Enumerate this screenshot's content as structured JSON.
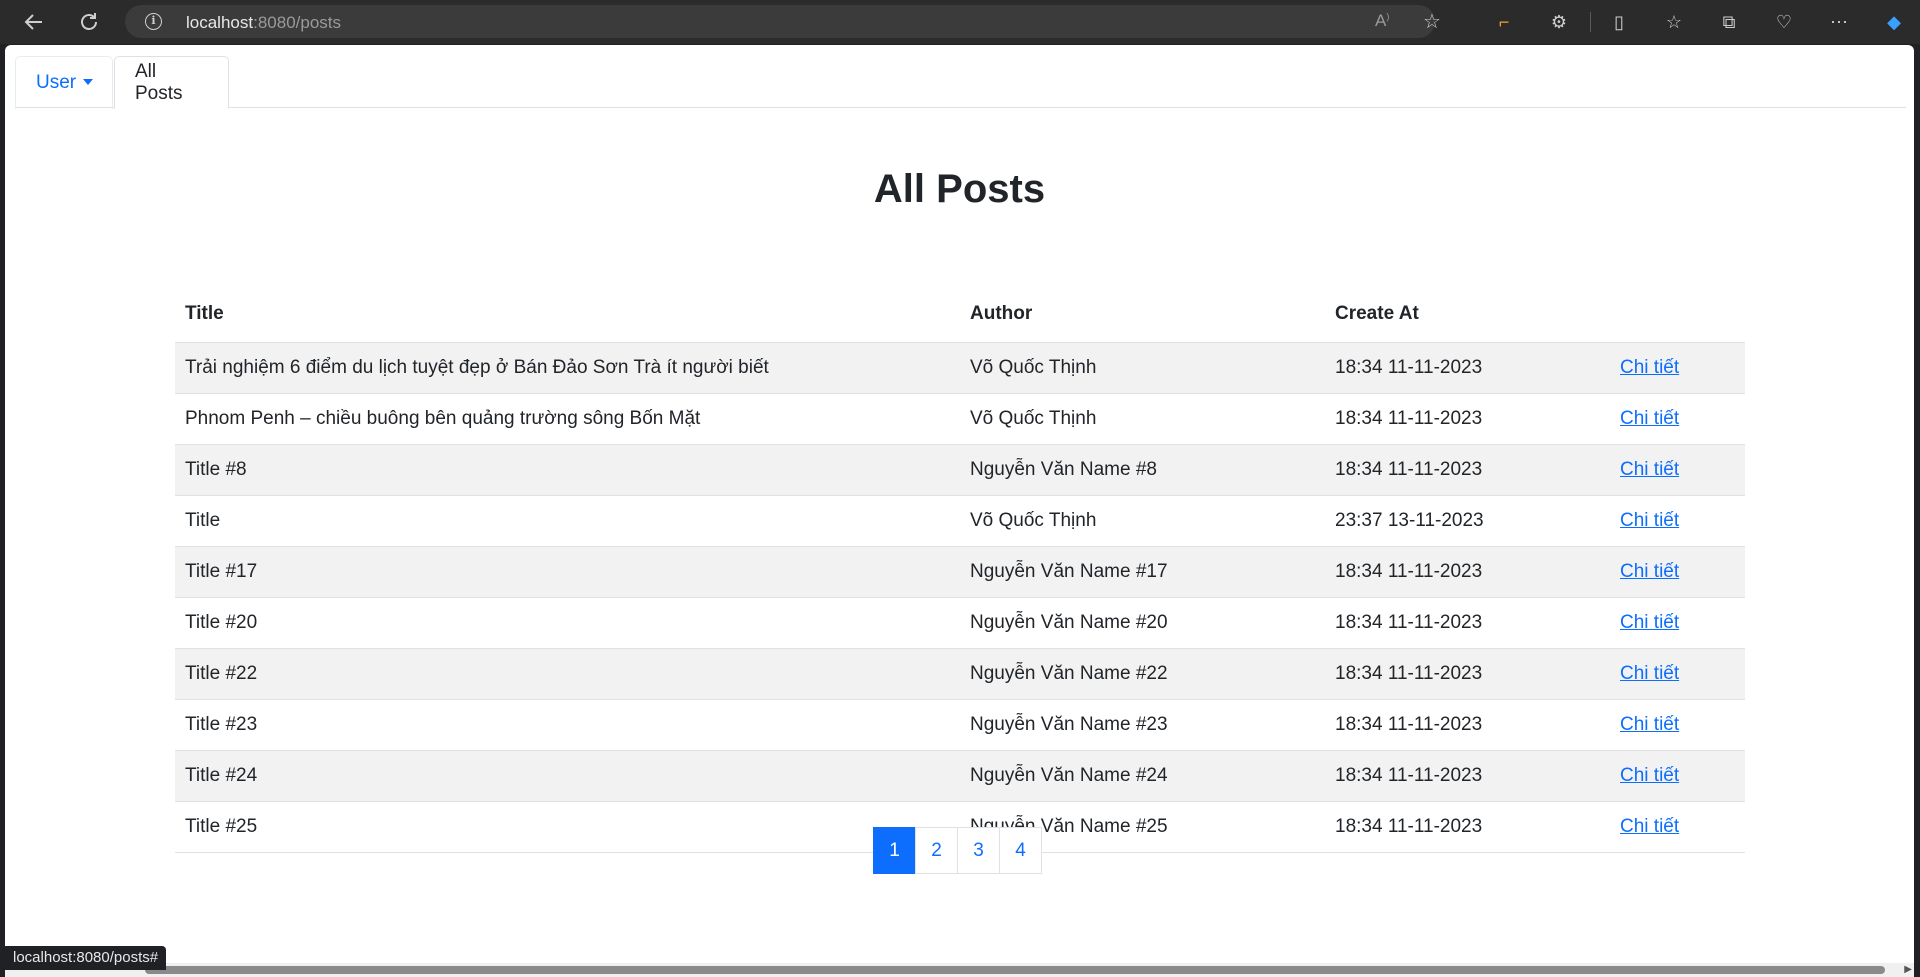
{
  "browser": {
    "url_host": "localhost",
    "url_rest": ":8080/posts",
    "status_url": "localhost:8080/posts#"
  },
  "tabs": {
    "user_label": "User",
    "posts_label": "All Posts"
  },
  "page_title": "All Posts",
  "table": {
    "headers": [
      "Title",
      "Author",
      "Create At",
      ""
    ],
    "link_label": "Chi tiết",
    "rows": [
      {
        "title": "Trải nghiệm 6 điểm du lịch tuyệt đẹp ở Bán Đảo Sơn Trà ít người biết",
        "author": "Võ Quốc Thịnh",
        "created": "18:34 11-11-2023",
        "link": "Chi tiết"
      },
      {
        "title": "Phnom Penh – chiều buông bên quảng trường sông Bốn Mặt",
        "author": "Võ Quốc Thịnh",
        "created": "18:34 11-11-2023",
        "link": "Chi tiết"
      },
      {
        "title": "Title #8",
        "author": "Nguyễn Văn Name #8",
        "created": "18:34 11-11-2023",
        "link": "Chi tiết"
      },
      {
        "title": "Title",
        "author": "Võ Quốc Thịnh",
        "created": "23:37 13-11-2023",
        "link": "Chi tiết"
      },
      {
        "title": "Title #17",
        "author": "Nguyễn Văn Name #17",
        "created": "18:34 11-11-2023",
        "link": "Chi tiết"
      },
      {
        "title": "Title #20",
        "author": "Nguyễn Văn Name #20",
        "created": "18:34 11-11-2023",
        "link": "Chi tiết"
      },
      {
        "title": "Title #22",
        "author": "Nguyễn Văn Name #22",
        "created": "18:34 11-11-2023",
        "link": "Chi tiết"
      },
      {
        "title": "Title #23",
        "author": "Nguyễn Văn Name #23",
        "created": "18:34 11-11-2023",
        "link": "Chi tiết"
      },
      {
        "title": "Title #24",
        "author": "Nguyễn Văn Name #24",
        "created": "18:34 11-11-2023",
        "link": "Chi tiết"
      },
      {
        "title": "Title #25",
        "author": "Nguyễn Văn Name #25",
        "created": "18:34 11-11-2023",
        "link": "Chi tiết"
      }
    ]
  },
  "pagination": {
    "pages": [
      "1",
      "2",
      "3",
      "4"
    ],
    "active": "1"
  },
  "colors": {
    "accent": "#0d6efd",
    "stripe": "#f2f2f2"
  }
}
